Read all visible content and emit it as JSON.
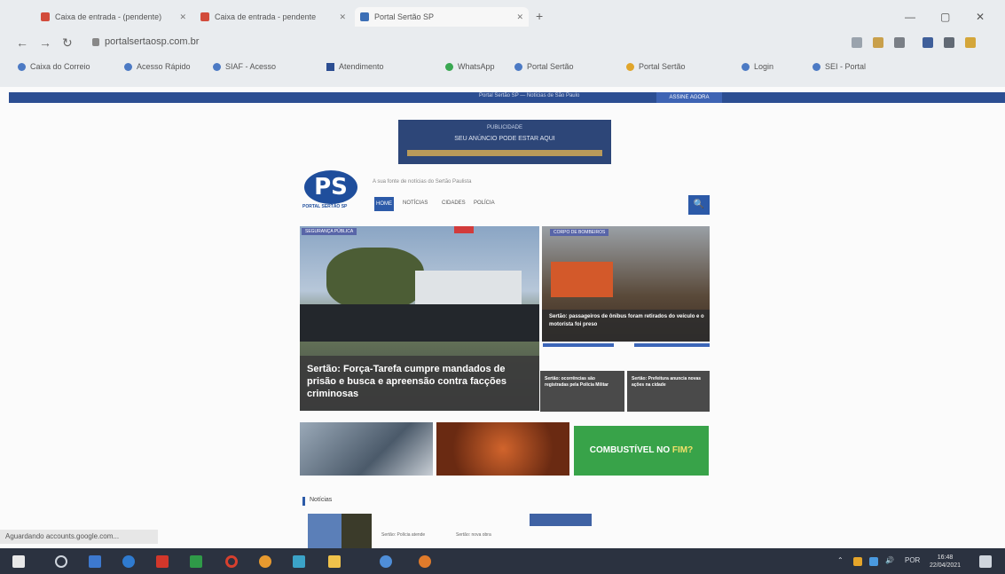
{
  "browser": {
    "tabs": [
      {
        "title": "Caixa de entrada - (pendente)",
        "active": false
      },
      {
        "title": "Caixa de entrada - pendente",
        "active": false
      },
      {
        "title": "Portal Sertão SP",
        "active": true
      }
    ],
    "new_tab": "+",
    "url": "portalsertaosp.com.br",
    "bookmarks": [
      "Caixa do Correio",
      "Acesso Rápido",
      "SIAF - Acesso",
      "Atendimento",
      "WhatsApp",
      "Portal Sertão",
      "Portal Sertão",
      "Login",
      "SEI - Portal"
    ],
    "window_controls": {
      "min": "—",
      "max": "▢",
      "close": "✕"
    }
  },
  "site": {
    "top_strip_text": "Portal Sertão SP — Notícias de São Paulo",
    "top_button": "ASSINE AGORA",
    "banner": {
      "line1": "PUBLICIDADE",
      "line2": "SEU ANÚNCIO PODE ESTAR AQUI"
    },
    "logo_text": "PS",
    "logo_sub": "PORTAL SERTÃO SP",
    "tagline": "A sua fonte de notícias do Sertão Paulista",
    "menu": [
      "HOME",
      "NOTÍCIAS",
      "CIDADES",
      "POLÍCIA"
    ],
    "search_icon": "🔍",
    "hero": {
      "tag": "SEGURANÇA PÚBLICA",
      "title": "Sertão: Força-Tarefa cumpre mandados de prisão e busca e apreensão contra facções criminosas"
    },
    "side_top": {
      "tag": "CORPO DE BOMBEIROS",
      "title": "Sertão: passageiros de ônibus foram retirados do veículo e o motorista foi preso"
    },
    "small_cards": [
      "Sertão: ocorrências são registradas pela Polícia Militar",
      "Sertão: Prefeitura anuncia novas ações na cidade"
    ],
    "combust_text1": "COMBUSTÍVEL NO",
    "combust_text2": "FIM?",
    "section_title": "Notícias",
    "news_snippets": [
      "Sertão: Polícia atende",
      "Sertão: nova obra"
    ]
  },
  "status_bar": "Aguardando accounts.google.com...",
  "taskbar": {
    "time": "16:48",
    "date": "22/04/2021"
  }
}
